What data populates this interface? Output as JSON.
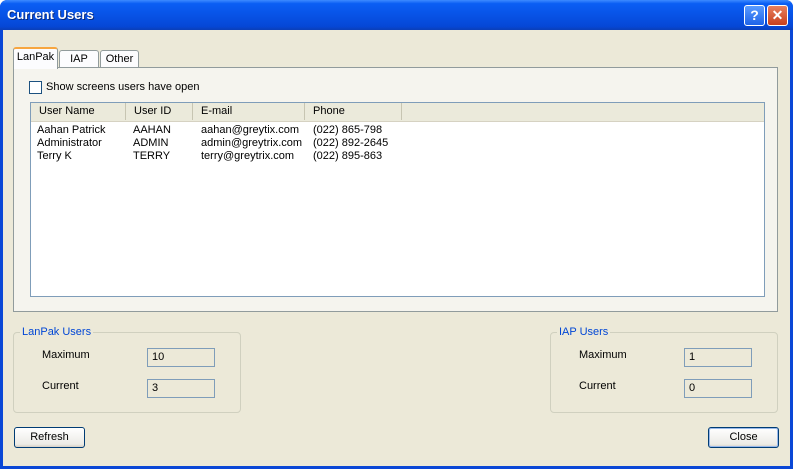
{
  "window": {
    "title": "Current Users",
    "help_glyph": "?",
    "close_glyph": "✕"
  },
  "tabs": [
    {
      "label": "LanPak",
      "active": true
    },
    {
      "label": "IAP",
      "active": false
    },
    {
      "label": "Other",
      "active": false
    }
  ],
  "options": {
    "show_screens_label": "Show screens users have open",
    "show_screens_checked": false
  },
  "users_table": {
    "columns": [
      "User Name",
      "User ID",
      "E-mail",
      "Phone"
    ],
    "rows": [
      [
        "Aahan Patrick",
        "AAHAN",
        "aahan@greytix.com",
        "(022) 865-798"
      ],
      [
        "Administrator",
        "ADMIN",
        "admin@greytrix.com",
        "(022) 892-2645"
      ],
      [
        "Terry K",
        "TERRY",
        "terry@greytrix.com",
        "(022) 895-863"
      ]
    ]
  },
  "lanpak_users": {
    "title": "LanPak Users",
    "maximum_label": "Maximum",
    "maximum_value": "10",
    "current_label": "Current",
    "current_value": "3"
  },
  "iap_users": {
    "title": "IAP Users",
    "maximum_label": "Maximum",
    "maximum_value": "1",
    "current_label": "Current",
    "current_value": "0"
  },
  "buttons": {
    "refresh": "Refresh",
    "close": "Close"
  },
  "colors": {
    "title_bar": "#0a5ef4",
    "group_title": "#0046d5",
    "active_tab_accent": "#f7a640"
  }
}
